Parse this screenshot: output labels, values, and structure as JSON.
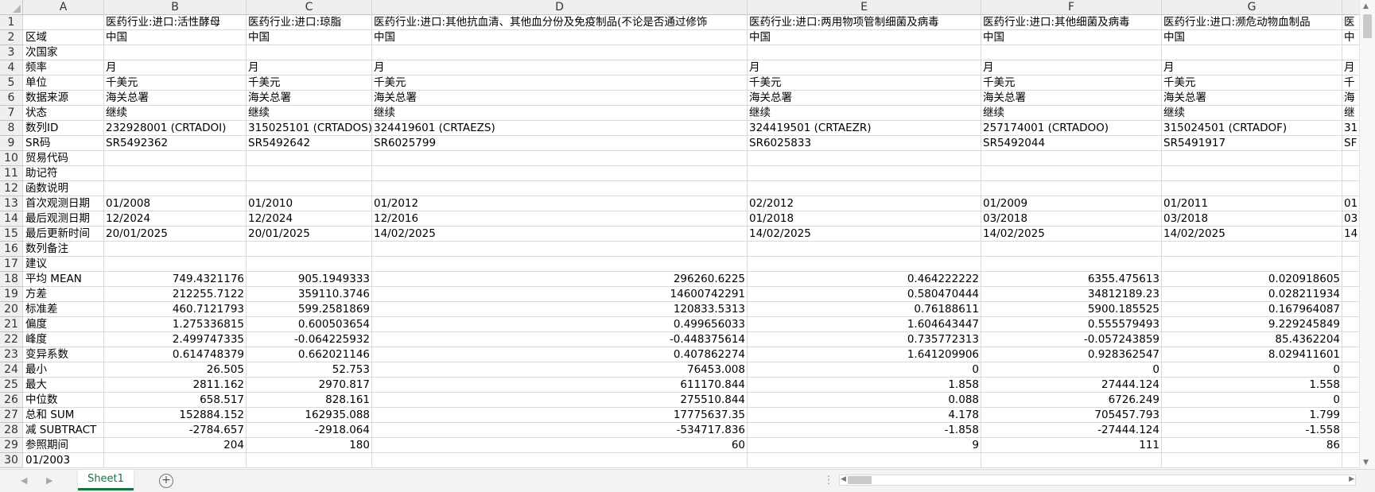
{
  "columns": [
    "A",
    "B",
    "C",
    "D",
    "E",
    "F",
    "G",
    ""
  ],
  "rows": [
    [
      "",
      "医药行业:进口:活性酵母",
      "医药行业:进口:琼脂",
      "医药行业:进口:其他抗血清、其他血分份及免疫制品(不论是否通过修饰",
      "医药行业:进口:两用物项管制细菌及病毒",
      "医药行业:进口:其他细菌及病毒",
      "医药行业:进口:濒危动物血制品",
      "医"
    ],
    [
      "区域",
      "中国",
      "中国",
      "中国",
      "中国",
      "中国",
      "中国",
      "中"
    ],
    [
      "次国家",
      "",
      "",
      "",
      "",
      "",
      "",
      ""
    ],
    [
      "频率",
      "月",
      "月",
      "月",
      "月",
      "月",
      "月",
      "月"
    ],
    [
      "单位",
      "千美元",
      "千美元",
      "千美元",
      "千美元",
      "千美元",
      "千美元",
      "千"
    ],
    [
      "数据来源",
      "海关总署",
      "海关总署",
      "海关总署",
      "海关总署",
      "海关总署",
      "海关总署",
      "海"
    ],
    [
      "状态",
      "继续",
      "继续",
      "继续",
      "继续",
      "继续",
      "继续",
      "继"
    ],
    [
      "数列ID",
      "232928001 (CRTADOI)",
      "315025101 (CRTADOS)",
      "324419601 (CRTAEZS)",
      "324419501 (CRTAEZR)",
      "257174001 (CRTADOO)",
      "315024501 (CRTADOF)",
      "31"
    ],
    [
      "SR码",
      "SR5492362",
      "SR5492642",
      "SR6025799",
      "SR6025833",
      "SR5492044",
      "SR5491917",
      "SF"
    ],
    [
      "贸易代码",
      "",
      "",
      "",
      "",
      "",
      "",
      ""
    ],
    [
      "助记符",
      "",
      "",
      "",
      "",
      "",
      "",
      ""
    ],
    [
      "函数说明",
      "",
      "",
      "",
      "",
      "",
      "",
      ""
    ],
    [
      "首次观测日期",
      "01/2008",
      "01/2010",
      "01/2012",
      "02/2012",
      "01/2009",
      "01/2011",
      "01"
    ],
    [
      "最后观测日期",
      "12/2024",
      "12/2024",
      "12/2016",
      "01/2018",
      "03/2018",
      "03/2018",
      "03"
    ],
    [
      "最后更新时间",
      "20/01/2025",
      "20/01/2025",
      "14/02/2025",
      "14/02/2025",
      "14/02/2025",
      "14/02/2025",
      "14"
    ],
    [
      "数列备注",
      "",
      "",
      "",
      "",
      "",
      "",
      ""
    ],
    [
      "建议",
      "",
      "",
      "",
      "",
      "",
      "",
      ""
    ],
    [
      "平均 MEAN",
      "749.4321176",
      "905.1949333",
      "296260.6225",
      "0.464222222",
      "6355.475613",
      "0.020918605",
      ""
    ],
    [
      "方差",
      "212255.7122",
      "359110.3746",
      "14600742291",
      "0.580470444",
      "34812189.23",
      "0.028211934",
      ""
    ],
    [
      "标准差",
      "460.7121793",
      "599.2581869",
      "120833.5313",
      "0.76188611",
      "5900.185525",
      "0.167964087",
      ""
    ],
    [
      "偏度",
      "1.275336815",
      "0.600503654",
      "0.499656033",
      "1.604643447",
      "0.555579493",
      "9.229245849",
      ""
    ],
    [
      "峰度",
      "2.499747335",
      "-0.064225932",
      "-0.448375614",
      "0.735772313",
      "-0.057243859",
      "85.4362204",
      ""
    ],
    [
      "变异系数",
      "0.614748379",
      "0.662021146",
      "0.407862274",
      "1.641209906",
      "0.928362547",
      "8.029411601",
      ""
    ],
    [
      "最小",
      "26.505",
      "52.753",
      "76453.008",
      "0",
      "0",
      "0",
      ""
    ],
    [
      "最大",
      "2811.162",
      "2970.817",
      "611170.844",
      "1.858",
      "27444.124",
      "1.558",
      ""
    ],
    [
      "中位数",
      "658.517",
      "828.161",
      "275510.844",
      "0.088",
      "6726.249",
      "0",
      ""
    ],
    [
      "总和 SUM",
      "152884.152",
      "162935.088",
      "17775637.35",
      "4.178",
      "705457.793",
      "1.799",
      ""
    ],
    [
      "减 SUBTRACT",
      "-2784.657",
      "-2918.064",
      "-534717.836",
      "-1.858",
      "-27444.124",
      "-1.558",
      ""
    ],
    [
      "参照期间",
      "204",
      "180",
      "60",
      "9",
      "111",
      "86",
      ""
    ],
    [
      "01/2003",
      "",
      "",
      "",
      "",
      "",
      "",
      ""
    ]
  ],
  "sheet_tab": "Sheet1",
  "add_sheet_symbol": "+",
  "dots_symbol": "⋮",
  "scroll_left_symbol": "◀",
  "scroll_right_symbol": "▶",
  "scroll_up_symbol": "▲",
  "scroll_down_symbol": "▼",
  "nav_prev_symbol": "◀",
  "nav_next_symbol": "▶",
  "accent_color": "#1e7145"
}
